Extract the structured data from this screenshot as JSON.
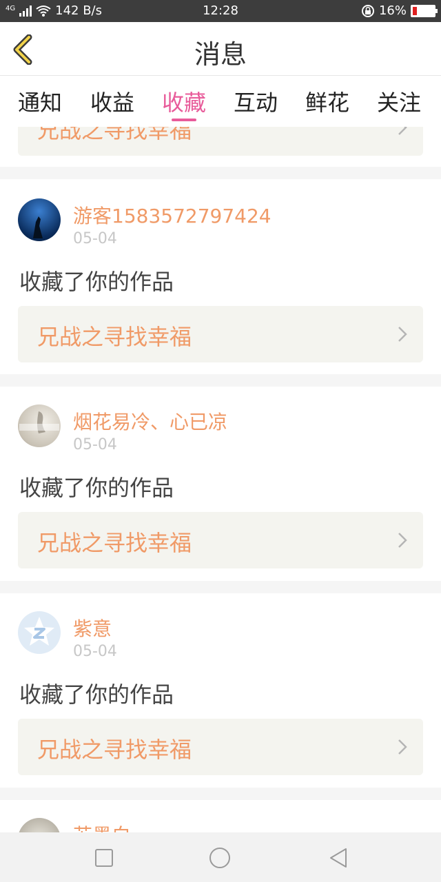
{
  "status_bar": {
    "network": "4G",
    "speed": "142 B/s",
    "time": "12:28",
    "battery": "16%",
    "battery_fraction": 0.16
  },
  "header": {
    "title": "消息",
    "back_icon": "chevron-left-icon"
  },
  "tabs": [
    {
      "label": "通知",
      "active": false
    },
    {
      "label": "收益",
      "active": false
    },
    {
      "label": "收藏",
      "active": true
    },
    {
      "label": "互动",
      "active": false
    },
    {
      "label": "鲜花",
      "active": false
    },
    {
      "label": "关注",
      "active": false
    }
  ],
  "items": [
    {
      "username": "",
      "date": "",
      "action": "",
      "work_title": "兄战之寻找幸福"
    },
    {
      "username": "游客1583572797424",
      "date": "05-04",
      "action": "收藏了你的作品",
      "work_title": "兄战之寻找幸福",
      "avatar": "blue-ocean-photo"
    },
    {
      "username": "烟花易冷、心已凉",
      "date": "05-04",
      "action": "收藏了你的作品",
      "work_title": "兄战之寻找幸福",
      "avatar": "sketch-photo"
    },
    {
      "username": "紫意",
      "date": "05-04",
      "action": "收藏了你的作品",
      "work_title": "兄战之寻找幸福",
      "avatar": "z-star-logo"
    },
    {
      "username": "苏墨白",
      "date": "",
      "action": "",
      "work_title": ""
    }
  ],
  "colors": {
    "accent": "#e85b9a",
    "username": "#f09a67",
    "work_bg": "#f4f4ef"
  },
  "nav": [
    "square-icon",
    "circle-icon",
    "triangle-back-icon"
  ]
}
